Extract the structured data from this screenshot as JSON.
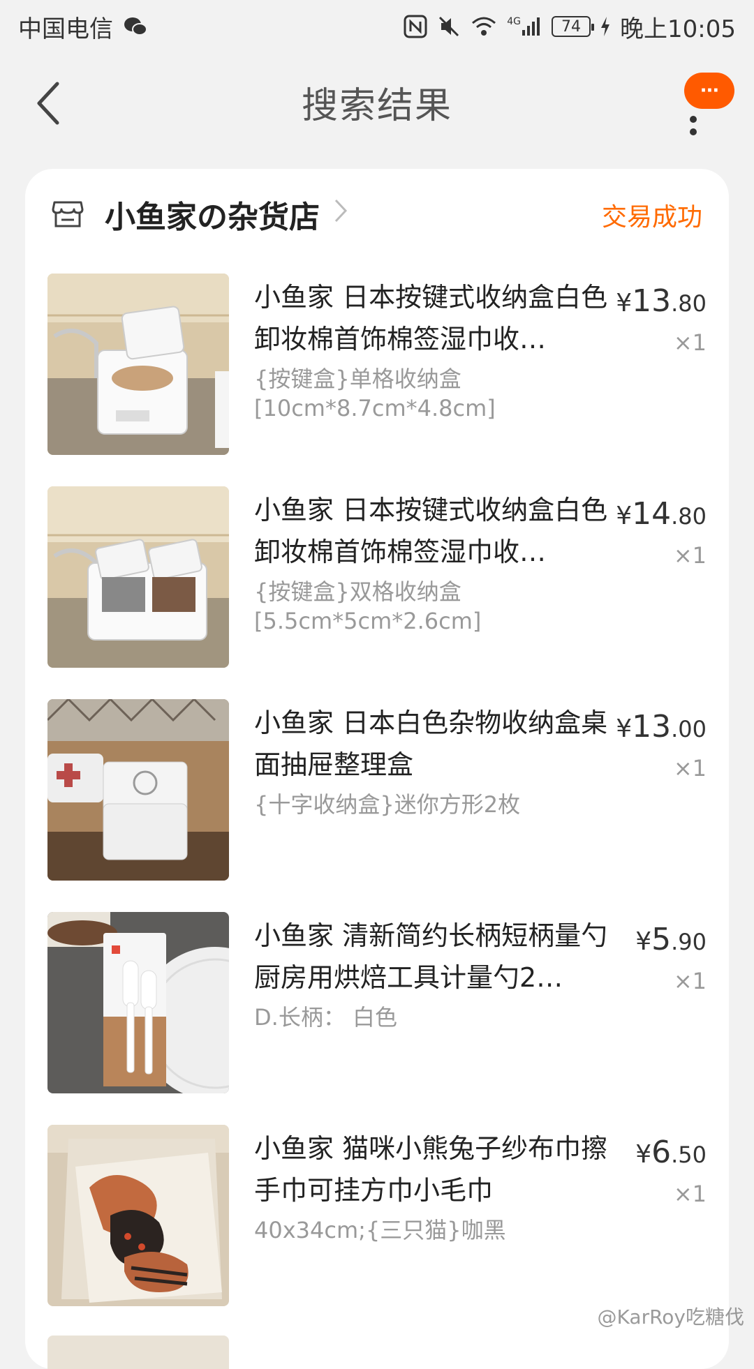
{
  "status_bar": {
    "carrier": "中国电信",
    "battery": "74",
    "time": "晚上10:05",
    "network": "4G"
  },
  "nav": {
    "title": "搜索结果",
    "more_badge": "···"
  },
  "shop": {
    "name": "小鱼家の杂货店",
    "status": "交易成功",
    "status_color": "#ff6a00"
  },
  "items": [
    {
      "title": "小鱼家 日本按键式收纳盒白色卸妆棉首饰棉签湿巾收…",
      "sku_line1": "{按键盒}单格收纳盒",
      "sku_line2": "[10cm*8.7cm*4.8cm]",
      "price_currency": "¥",
      "price_int": "13",
      "price_dec": ".80",
      "qty": "×1"
    },
    {
      "title": "小鱼家 日本按键式收纳盒白色卸妆棉首饰棉签湿巾收…",
      "sku_line1": "{按键盒}双格收纳盒",
      "sku_line2": "[5.5cm*5cm*2.6cm]",
      "price_currency": "¥",
      "price_int": "14",
      "price_dec": ".80",
      "qty": "×1"
    },
    {
      "title": "小鱼家 日本白色杂物收纳盒桌面抽屉整理盒",
      "sku_line1": "{十字收纳盒}迷你方形2枚",
      "sku_line2": "",
      "price_currency": "¥",
      "price_int": "13",
      "price_dec": ".00",
      "qty": "×1"
    },
    {
      "title": "小鱼家 清新简约长柄短柄量勺厨房用烘焙工具计量勺2…",
      "sku_line1": "D.长柄： 白色",
      "sku_line2": "",
      "price_currency": "¥",
      "price_int": "5",
      "price_dec": ".90",
      "qty": "×1"
    },
    {
      "title": "小鱼家 猫咪小熊兔子纱布巾擦手巾可挂方巾小毛巾",
      "sku_line1": "40x34cm;{三只猫}咖黑",
      "sku_line2": "",
      "price_currency": "¥",
      "price_int": "6",
      "price_dec": ".50",
      "qty": "×1"
    }
  ],
  "watermark": "@KarRoy吃糖伐",
  "colors": {
    "accent": "#ff5a00",
    "background": "#f2f2f2"
  }
}
